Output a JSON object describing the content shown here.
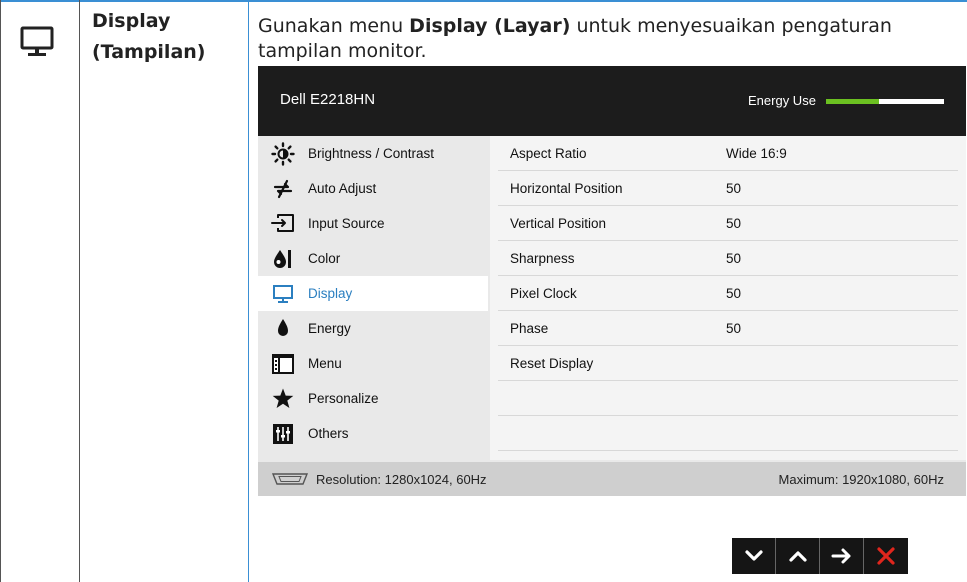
{
  "table": {
    "icon": "monitor-icon",
    "feature_title": "Display (Tampilan)",
    "desc_pre": "Gunakan menu ",
    "desc_bold": "Display (Layar)",
    "desc_post": " untuk menyesuaikan pengaturan tampilan monitor."
  },
  "osd": {
    "model": "Dell E2218HN",
    "energy_label": "Energy Use",
    "energy_level": 0.45,
    "colors": {
      "accent": "#2b7fc0",
      "energy_green": "#6bc021",
      "header_bg": "#1c1c1c"
    },
    "menu": [
      {
        "label": "Brightness / Contrast",
        "icon": "brightness-icon",
        "selected": false
      },
      {
        "label": "Auto Adjust",
        "icon": "auto-adjust-icon",
        "selected": false
      },
      {
        "label": "Input Source",
        "icon": "input-source-icon",
        "selected": false
      },
      {
        "label": "Color",
        "icon": "color-icon",
        "selected": false
      },
      {
        "label": "Display",
        "icon": "display-icon",
        "selected": true
      },
      {
        "label": "Energy",
        "icon": "energy-icon",
        "selected": false
      },
      {
        "label": "Menu",
        "icon": "menu-icon",
        "selected": false
      },
      {
        "label": "Personalize",
        "icon": "star-icon",
        "selected": false
      },
      {
        "label": "Others",
        "icon": "others-icon",
        "selected": false
      }
    ],
    "settings": [
      {
        "label": "Aspect Ratio",
        "value": "Wide 16:9"
      },
      {
        "label": "Horizontal Position",
        "value": "50"
      },
      {
        "label": "Vertical Position",
        "value": "50"
      },
      {
        "label": "Sharpness",
        "value": "50"
      },
      {
        "label": "Pixel Clock",
        "value": "50"
      },
      {
        "label": "Phase",
        "value": "50"
      },
      {
        "label": "Reset Display",
        "value": ""
      },
      {
        "label": "",
        "value": ""
      },
      {
        "label": "",
        "value": ""
      }
    ],
    "footer": {
      "resolution": "Resolution: 1280x1024, 60Hz",
      "maximum": "Maximum: 1920x1080, 60Hz"
    }
  },
  "buttons": [
    {
      "icon": "chevron-down-icon"
    },
    {
      "icon": "chevron-up-icon"
    },
    {
      "icon": "arrow-right-icon"
    },
    {
      "icon": "close-icon"
    }
  ]
}
